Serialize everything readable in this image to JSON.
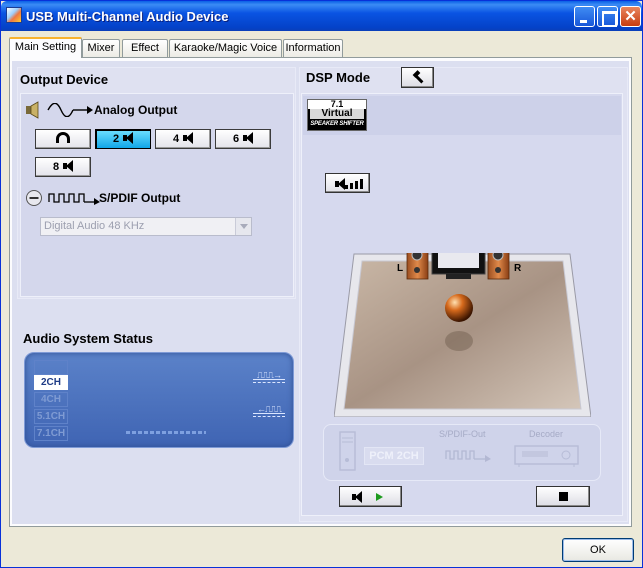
{
  "window": {
    "title": "USB Multi-Channel Audio Device"
  },
  "tabs": [
    {
      "label": "Main Setting",
      "active": true
    },
    {
      "label": "Mixer"
    },
    {
      "label": "Effect"
    },
    {
      "label": "Karaoke/Magic Voice"
    },
    {
      "label": "Information"
    }
  ],
  "output_device": {
    "title": "Output Device",
    "analog_label": "Analog Output",
    "speaker_buttons": [
      {
        "label": "",
        "icon": "headphone-icon"
      },
      {
        "label": "2",
        "selected": true
      },
      {
        "label": "4"
      },
      {
        "label": "6"
      },
      {
        "label": "8"
      }
    ],
    "spdif_label": "S/PDIF Output",
    "spdif_select_value": "Digital Audio 48 KHz"
  },
  "audio_status": {
    "title": "Audio System Status",
    "channels": [
      {
        "label": "",
        "active": false
      },
      {
        "label": "2CH",
        "active": true
      },
      {
        "label": "4CH",
        "active": false
      },
      {
        "label": "5.1CH",
        "active": false
      },
      {
        "label": "7.1CH",
        "active": false
      }
    ]
  },
  "dsp": {
    "title": "DSP Mode",
    "virtual_badge": {
      "top": "7.1",
      "mid": "Virtual",
      "bottom": "SPEAKER SHIFTER"
    },
    "room_labels": {
      "left": "L",
      "right": "R"
    },
    "chain": {
      "pcm": "PCM 2CH",
      "spdif_out": "S/PDIF-Out",
      "decoder": "Decoder"
    }
  },
  "buttons": {
    "ok": "OK"
  },
  "colors": {
    "title_bar": "#0a54e3",
    "selected_button": "#11a6e8",
    "status_panel": "#4a6fbd"
  }
}
